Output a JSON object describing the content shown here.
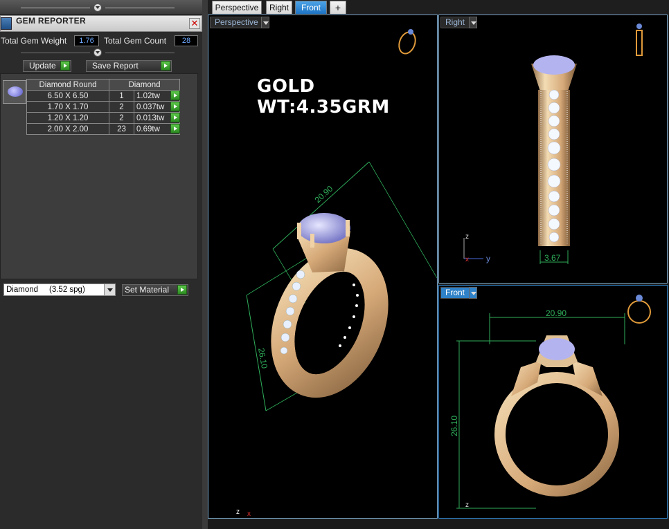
{
  "gem_reporter": {
    "title": "GEM REPORTER",
    "close": "✕",
    "total_gem_weight_label": "Total Gem Weight",
    "total_gem_weight": "1.76",
    "total_gem_count_label": "Total Gem Count",
    "total_gem_count": "28",
    "update_label": "Update",
    "save_report_label": "Save Report",
    "table": {
      "headers": [
        "Diamond Round",
        "Diamond"
      ],
      "rows": [
        {
          "size": "6.50 X 6.50",
          "count": "1",
          "weight": "1.02tw"
        },
        {
          "size": "1.70 X 1.70",
          "count": "2",
          "weight": "0.037tw"
        },
        {
          "size": "1.20 X 1.20",
          "count": "2",
          "weight": "0.013tw"
        },
        {
          "size": "2.00 X 2.00",
          "count": "23",
          "weight": "0.69tw"
        }
      ]
    },
    "material": "Diamond     (3.52 spg)",
    "set_material_label": "Set Material"
  },
  "tabs": [
    "Perspective",
    "Right",
    "Front",
    "+"
  ],
  "active_tab": "Front",
  "viewports": {
    "perspective": {
      "label": "Perspective",
      "annotation": "GOLD WT:4.35GRM",
      "dim_top": "20.90",
      "dim_side": "26.10"
    },
    "right": {
      "label": "Right",
      "dim": "3.67",
      "axis_z": "z",
      "axis_y": "y",
      "axis_x": "x"
    },
    "front": {
      "label": "Front",
      "dim_top": "20.90",
      "dim_side": "26.10",
      "axis_z": "z"
    }
  },
  "colors": {
    "accent": "#2f82c8",
    "gold": "#e7c79a",
    "dimension": "#2fae5a",
    "gem": "#b3b3f0"
  }
}
